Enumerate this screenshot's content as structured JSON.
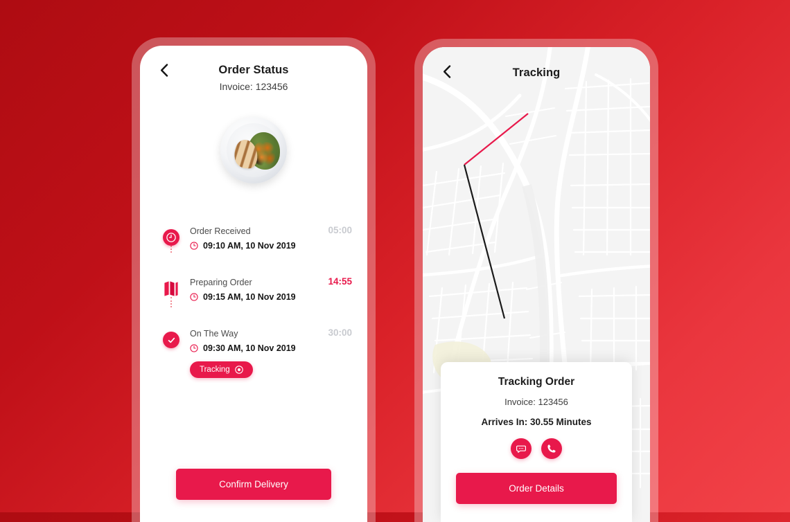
{
  "theme": {
    "accent": "#e8194b",
    "background_start": "#ae0c12",
    "background_end": "#f24248",
    "muted_text": "#c9cbd0"
  },
  "order_status_screen": {
    "back_icon": "chevron-left-icon",
    "title": "Order Status",
    "subtitle": "Invoice: 123456",
    "food_image_alt": "grilled-chicken-salad-plate",
    "timeline": [
      {
        "icon": "clock-icon",
        "label": "Order Received",
        "time_icon": "clock-outline-icon",
        "datetime": "09:10 AM, 10 Nov 2019",
        "duration": "05:00",
        "duration_state": "muted"
      },
      {
        "icon": "map-icon",
        "label": "Preparing Order",
        "time_icon": "clock-outline-icon",
        "datetime": "09:15 AM, 10 Nov 2019",
        "duration": "14:55",
        "duration_state": "active"
      },
      {
        "icon": "check-icon",
        "label": "On The Way",
        "time_icon": "clock-outline-icon",
        "datetime": "09:30 AM, 10 Nov 2019",
        "duration": "30:00",
        "duration_state": "muted",
        "pill_label": "Tracking",
        "pill_icon": "target-icon"
      }
    ],
    "confirm_button": "Confirm Delivery"
  },
  "tracking_screen": {
    "back_icon": "chevron-left-icon",
    "title": "Tracking",
    "map": {
      "restaurant_marker_icon": "fork-spoon-icon",
      "destination_marker_icon": "location-pulse-icon",
      "route_segment_travelled_color": "#e8194b",
      "route_segment_remaining_color": "#1a1a1a"
    },
    "card": {
      "title": "Tracking Order",
      "invoice": "Invoice: 123456",
      "eta": "Arrives In: 30.55 Minutes",
      "actions": [
        {
          "name": "chat-icon"
        },
        {
          "name": "phone-icon"
        }
      ],
      "details_button": "Order Details"
    }
  }
}
